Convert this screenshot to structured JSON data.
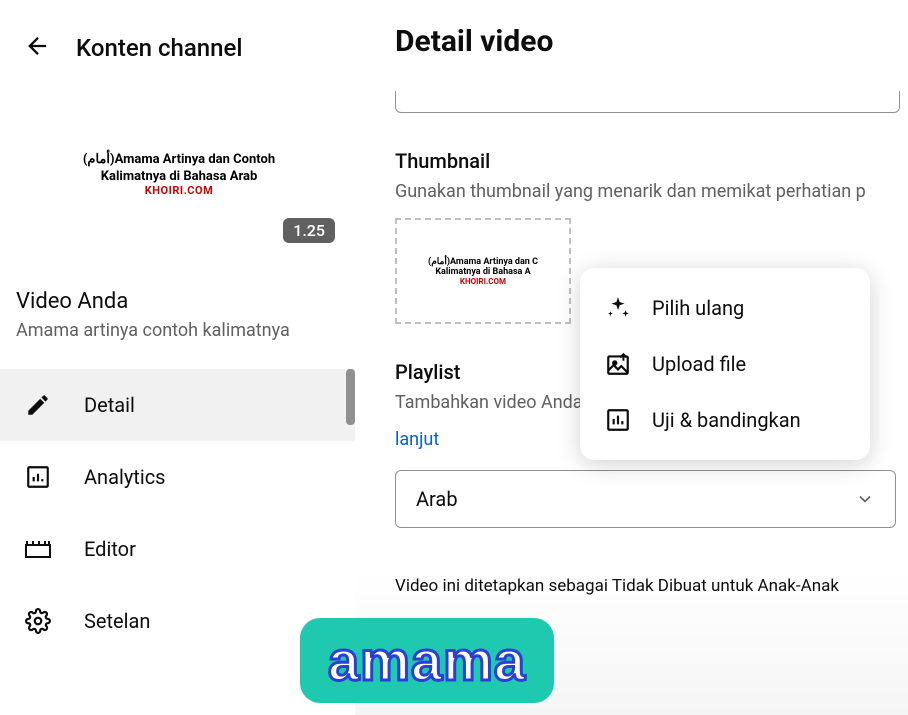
{
  "sidebar": {
    "header_title": "Konten channel",
    "video_card": {
      "thumb_line1": "(أمام)Amama Artinya dan Contoh",
      "thumb_line2": "Kalimatnya di Bahasa Arab",
      "thumb_brand": "KHOIRI.COM",
      "duration": "1.25"
    },
    "video_info": {
      "label": "Video Anda",
      "name": "Amama artinya contoh kalimatnya"
    },
    "nav": [
      {
        "label": "Detail"
      },
      {
        "label": "Analytics"
      },
      {
        "label": "Editor"
      },
      {
        "label": "Setelan"
      }
    ]
  },
  "main": {
    "title": "Detail video",
    "thumbnail": {
      "title": "Thumbnail",
      "desc": "Gunakan thumbnail yang menarik dan memikat perhatian p",
      "preview": {
        "line1": "(أمام)Amama Artinya dan C",
        "line2": "Kalimatnya di Bahasa A",
        "brand": "KHOIRI.COM"
      }
    },
    "playlist": {
      "title": "Playlist",
      "desc": "Tambahkan video Anda ke satu atau beberapa playlist untu",
      "link": "lanjut",
      "selected": "Arab"
    },
    "audience_text": "Video ini ditetapkan sebagai Tidak Dibuat untuk Anak-Anak"
  },
  "popup": {
    "items": [
      {
        "label": "Pilih ulang"
      },
      {
        "label": "Upload file"
      },
      {
        "label": "Uji & bandingkan"
      }
    ]
  },
  "caption": "amama"
}
